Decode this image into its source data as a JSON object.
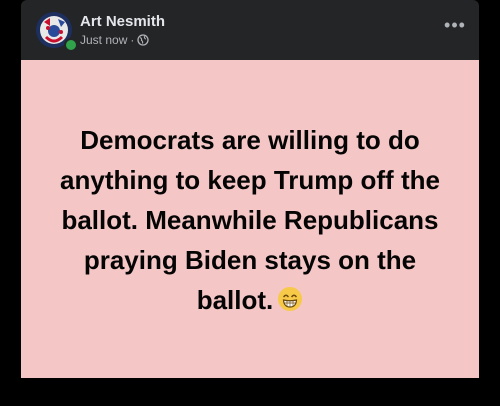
{
  "post": {
    "author_name": "Art Nesmith",
    "timestamp": "Just now",
    "separator": "·",
    "privacy_icon": "globe-icon",
    "more_options_icon": "more-options-icon",
    "more_options_glyph": "•••",
    "body_text": "Democrats are willing to do anything to keep Trump off the ballot. Meanwhile Republicans praying Biden stays on the ballot.",
    "emoji": "grinning-face-with-smiling-eyes",
    "background_color": "#f5c6c6",
    "online_status_color": "#31a24c"
  }
}
